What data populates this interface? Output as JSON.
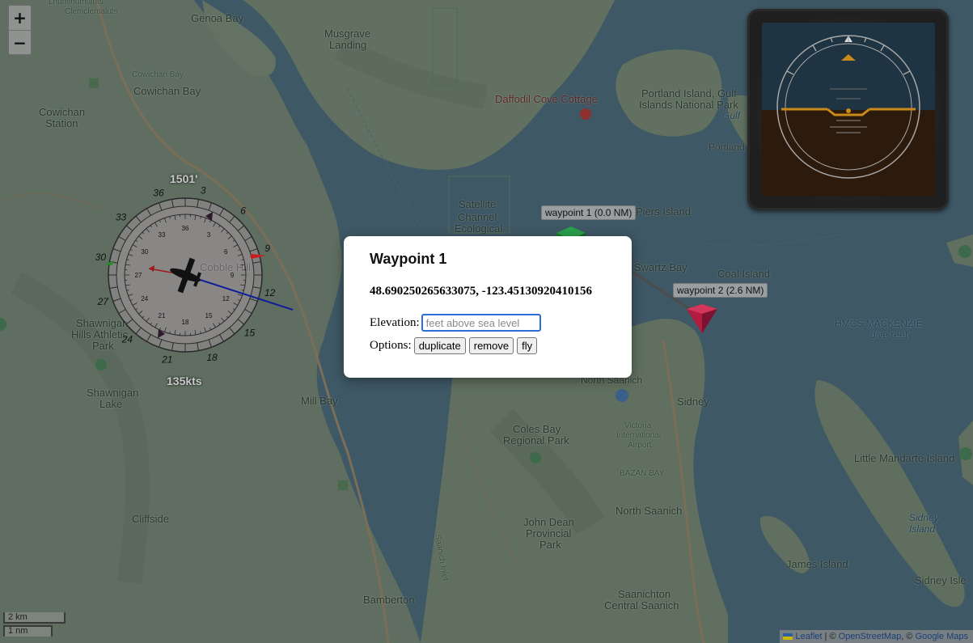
{
  "map": {
    "labels": [
      {
        "text": "Lhumlhumuluts'",
        "cls": "small",
        "pos": "l1"
      },
      {
        "text": "Clemclemaluts",
        "cls": "small",
        "pos": "l2"
      },
      {
        "text": "Genoa Bay",
        "cls": "lg",
        "pos": "l3"
      },
      {
        "text": "Musgrave",
        "cls": "lg",
        "pos": "l4"
      },
      {
        "text": "Landing",
        "cls": "lg",
        "pos": "l5"
      },
      {
        "text": "Cowichan Bay",
        "cls": "small",
        "pos": "l6"
      },
      {
        "text": "Cowichan Bay",
        "cls": "lg",
        "pos": "l7"
      },
      {
        "text": "Cowichan",
        "cls": "lg",
        "pos": "l8"
      },
      {
        "text": "Station",
        "cls": "lg",
        "pos": "l9"
      },
      {
        "text": "Daffodil Cove Cottage",
        "cls": "lg poi-red",
        "pos": "l10"
      },
      {
        "text": "Portland Island, Gulf",
        "cls": "lg",
        "pos": "l11"
      },
      {
        "text": "Islands National Park",
        "cls": "lg",
        "pos": "l12"
      },
      {
        "text": "Gulf",
        "cls": "water",
        "pos": "l13"
      },
      {
        "text": "Portland",
        "cls": "",
        "pos": "l14"
      },
      {
        "text": "Piers Island",
        "cls": "lg",
        "pos": "l15"
      },
      {
        "text": "Satellite",
        "cls": "lg",
        "pos": "l16"
      },
      {
        "text": "Channel",
        "cls": "lg",
        "pos": "l17"
      },
      {
        "text": "Ecological",
        "cls": "lg",
        "pos": "l18"
      },
      {
        "text": "Swartz Bay",
        "cls": "lg",
        "pos": "l19"
      },
      {
        "text": "Coal Island",
        "cls": "lg",
        "pos": "l20"
      },
      {
        "text": "HMCS MACKENZIE-",
        "cls": "water",
        "pos": "l21"
      },
      {
        "text": "dive reef",
        "cls": "water",
        "pos": "l22"
      },
      {
        "text": "Cobble Hill",
        "cls": "lg",
        "pos": "l23"
      },
      {
        "text": "Shawnigan",
        "cls": "lg",
        "pos": "l24"
      },
      {
        "text": "Hills Athletic",
        "cls": "lg",
        "pos": "l25"
      },
      {
        "text": "Park",
        "cls": "lg",
        "pos": "l26"
      },
      {
        "text": "Shawnigan",
        "cls": "lg",
        "pos": "l27"
      },
      {
        "text": "Lake",
        "cls": "lg",
        "pos": "l28"
      },
      {
        "text": "Mill Bay",
        "cls": "lg",
        "pos": "l29"
      },
      {
        "text": "North Saanich",
        "cls": "",
        "pos": "l30"
      },
      {
        "text": "Sidney",
        "cls": "lg",
        "pos": "l31"
      },
      {
        "text": "Victoria",
        "cls": "small",
        "pos": "l32"
      },
      {
        "text": "International",
        "cls": "small",
        "pos": "l33"
      },
      {
        "text": "Airport",
        "cls": "small",
        "pos": "l34"
      },
      {
        "text": "Coles Bay",
        "cls": "lg",
        "pos": "l35"
      },
      {
        "text": "Regional Park",
        "cls": "lg",
        "pos": "l36"
      },
      {
        "text": "BAZAN BAY",
        "cls": "small",
        "pos": "l37"
      },
      {
        "text": "Little Mandarte Island",
        "cls": "lg",
        "pos": "l38"
      },
      {
        "text": "North Saanich",
        "cls": "lg",
        "pos": "l39"
      },
      {
        "text": "John Dean",
        "cls": "lg",
        "pos": "l40"
      },
      {
        "text": "Provincial",
        "cls": "lg",
        "pos": "l41"
      },
      {
        "text": "Park",
        "cls": "lg",
        "pos": "l42"
      },
      {
        "text": "Cliffside",
        "cls": "lg",
        "pos": "l43"
      },
      {
        "text": "Sidney",
        "cls": "water",
        "pos": "l44"
      },
      {
        "text": "Island",
        "cls": "water",
        "pos": "l45"
      },
      {
        "text": "James Island",
        "cls": "lg",
        "pos": "l46"
      },
      {
        "text": "Sidney Isle",
        "cls": "lg",
        "pos": "l47"
      },
      {
        "text": "Bamberton",
        "cls": "lg",
        "pos": "l48"
      },
      {
        "text": "Saanichton",
        "cls": "lg",
        "pos": "l49"
      },
      {
        "text": "Central Saanich",
        "cls": "lg",
        "pos": "l50"
      },
      {
        "text": "Saanich Inlet",
        "cls": "small water",
        "pos": "l51"
      }
    ],
    "waypoint_tags": [
      {
        "text": "waypoint 1 (0.0 NM)",
        "pos": "t1"
      },
      {
        "text": "waypoint 2 (2.6 NM)",
        "pos": "t2"
      }
    ]
  },
  "zoom": {
    "in": "+",
    "out": "−"
  },
  "scale": {
    "km": "2 km",
    "nm": "1 nm"
  },
  "attribution": {
    "leaflet": "Leaflet",
    "sep1": " | © ",
    "osm": "OpenStreetMap",
    "sep2": ", © ",
    "google": "Google Maps"
  },
  "hud": {
    "altitude": "1501'",
    "speed": "135kts",
    "heading_outer": [
      "33",
      "36",
      "3",
      "6",
      "9",
      "12",
      "15",
      "18",
      "21",
      "24",
      "27",
      "30"
    ],
    "heading_inner": [
      "36",
      "33",
      "30",
      "27",
      "24",
      "21",
      "18",
      "15",
      "12",
      "9",
      "6",
      "3"
    ]
  },
  "popup": {
    "title": "Waypoint 1",
    "coords": "48.690250265633075, -123.45130920410156",
    "elevation_label": "Elevation:",
    "elevation_placeholder": "feet above sea level",
    "options_label": "Options:",
    "buttons": {
      "duplicate": "duplicate",
      "remove": "remove",
      "fly": "fly"
    }
  },
  "colors": {
    "map_land": "#5f6e60",
    "map_water": "#3d5664",
    "popup_bg": "#ffffff",
    "attitude_sky": "#1e3442",
    "attitude_ground": "#2c1a0c",
    "horizon": "#c98a1a",
    "waypoint1": "#1c8a3a",
    "waypoint2": "#a11b3c"
  }
}
